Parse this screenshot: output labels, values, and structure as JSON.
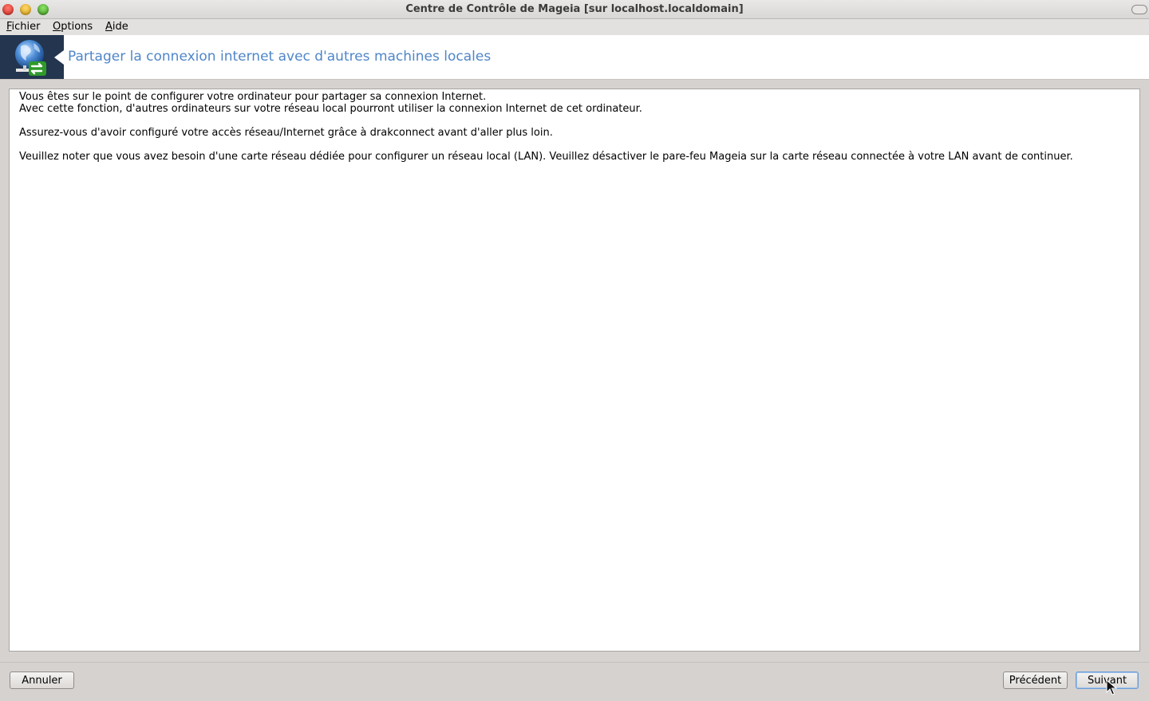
{
  "window": {
    "title": "Centre de Contrôle de Mageia  [sur localhost.localdomain]"
  },
  "menu": {
    "file": {
      "accel": "F",
      "rest": "ichier"
    },
    "options": {
      "accel": "O",
      "rest": "ptions"
    },
    "help": {
      "accel": "A",
      "rest": "ide"
    }
  },
  "header": {
    "icon": "network-sharing-globe-icon",
    "title": "Partager la connexion internet avec d'autres machines locales"
  },
  "content": {
    "line1": "Vous êtes sur le point de configurer votre ordinateur pour partager sa connexion Internet.",
    "line2": "Avec cette fonction, d'autres ordinateurs sur votre réseau local pourront utiliser la connexion Internet de cet ordinateur.",
    "line3": "Assurez-vous d'avoir configuré votre accès réseau/Internet grâce à drakconnect avant d'aller plus loin.",
    "line4": "Veuillez noter que vous avez besoin d'une carte réseau dédiée pour configurer un réseau local (LAN). Veuillez désactiver le pare-feu Mageia sur la carte réseau connectée à votre LAN avant de continuer."
  },
  "buttons": {
    "cancel": "Annuler",
    "previous": "Précédent",
    "next": "Suivant"
  },
  "colors": {
    "header_title": "#4f86c9",
    "header_icon_bg": "#23354f",
    "window_bg": "#d6d2d0"
  }
}
